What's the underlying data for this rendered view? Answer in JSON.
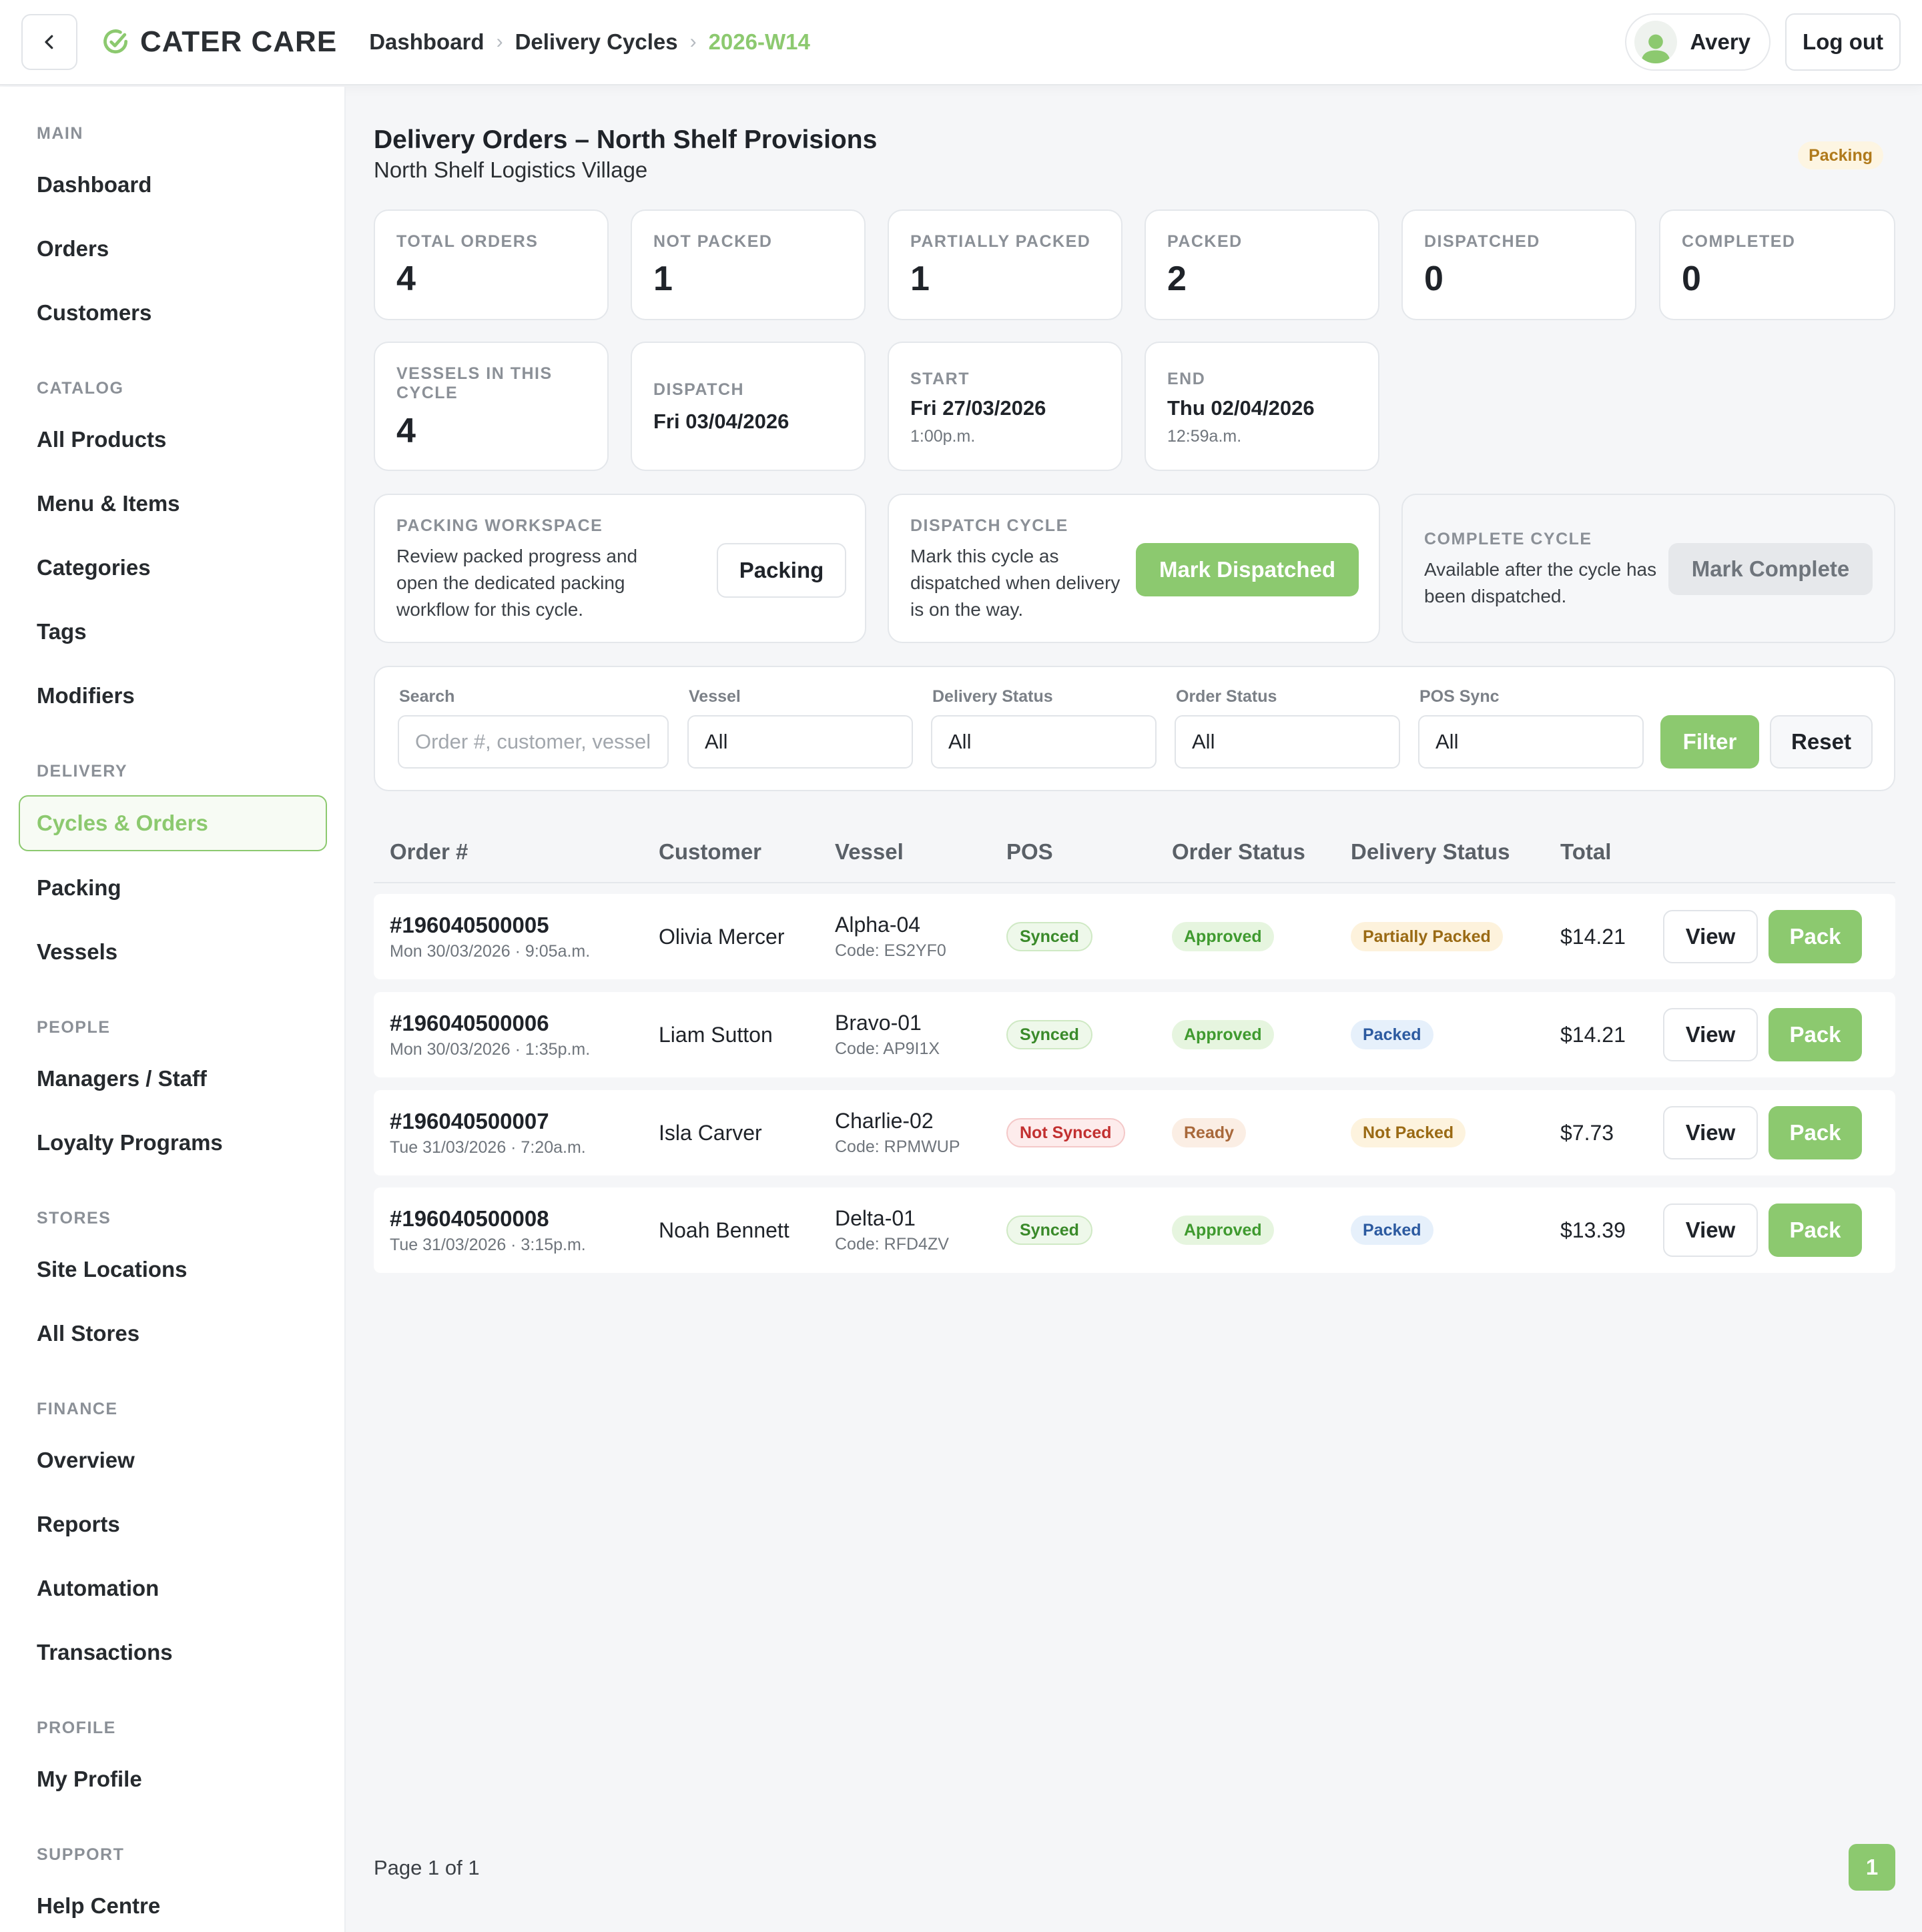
{
  "header": {
    "brand": "CATER CARE",
    "breadcrumbs": [
      "Dashboard",
      "Delivery Cycles",
      "2026-W14"
    ],
    "user_name": "Avery",
    "logout_label": "Log out",
    "accent_color": "#8cc96f"
  },
  "sidebar": {
    "sections": [
      {
        "title": "MAIN",
        "items": [
          "Dashboard",
          "Orders",
          "Customers"
        ]
      },
      {
        "title": "CATALOG",
        "items": [
          "All Products",
          "Menu & Items",
          "Categories",
          "Tags",
          "Modifiers"
        ]
      },
      {
        "title": "DELIVERY",
        "items": [
          "Cycles & Orders",
          "Packing",
          "Vessels"
        ]
      },
      {
        "title": "PEOPLE",
        "items": [
          "Managers / Staff",
          "Loyalty Programs"
        ]
      },
      {
        "title": "STORES",
        "items": [
          "Site Locations",
          "All Stores"
        ]
      },
      {
        "title": "FINANCE",
        "items": [
          "Overview",
          "Reports",
          "Automation",
          "Transactions"
        ]
      },
      {
        "title": "PROFILE",
        "items": [
          "My Profile"
        ]
      },
      {
        "title": "SUPPORT",
        "items": [
          "Help Centre"
        ]
      }
    ],
    "active_item": "Cycles & Orders"
  },
  "page": {
    "title": "Delivery Orders – North Shelf Provisions",
    "subtitle": "North Shelf Logistics Village",
    "status_badge": "Packing"
  },
  "stats": [
    {
      "label": "TOTAL ORDERS",
      "value": "4"
    },
    {
      "label": "NOT PACKED",
      "value": "1"
    },
    {
      "label": "PARTIALLY PACKED",
      "value": "1"
    },
    {
      "label": "PACKED",
      "value": "2"
    },
    {
      "label": "DISPATCHED",
      "value": "0"
    },
    {
      "label": "COMPLETED",
      "value": "0"
    }
  ],
  "cycle_info": {
    "vessels": {
      "label": "VESSELS IN THIS CYCLE",
      "value": "4"
    },
    "dispatch": {
      "label": "DISPATCH",
      "date": "Fri 03/04/2026"
    },
    "start": {
      "label": "START",
      "date": "Fri 27/03/2026",
      "time": "1:00p.m."
    },
    "end": {
      "label": "END",
      "date": "Thu 02/04/2026",
      "time": "12:59a.m."
    }
  },
  "actions": {
    "packing": {
      "label": "PACKING WORKSPACE",
      "desc": "Review packed progress and open the dedicated packing workflow for this cycle.",
      "button": "Packing"
    },
    "dispatch": {
      "label": "DISPATCH CYCLE",
      "desc": "Mark this cycle as dispatched when delivery is on the way.",
      "button": "Mark Dispatched"
    },
    "complete": {
      "label": "COMPLETE CYCLE",
      "desc": "Available after the cycle has been dispatched.",
      "button": "Mark Complete"
    }
  },
  "filters": {
    "search_label": "Search",
    "search_placeholder": "Order #, customer, vessel",
    "vessel_label": "Vessel",
    "vessel_value": "All",
    "delivery_label": "Delivery Status",
    "delivery_value": "All",
    "order_label": "Order Status",
    "order_value": "All",
    "pos_label": "POS Sync",
    "pos_value": "All",
    "filter_button": "Filter",
    "reset_button": "Reset"
  },
  "table": {
    "columns": [
      "Order #",
      "Customer",
      "Vessel",
      "POS",
      "Order Status",
      "Delivery Status",
      "Total"
    ],
    "view_label": "View",
    "pack_label": "Pack",
    "rows": [
      {
        "order": "#196040500005",
        "date": "Mon 30/03/2026 · 9:05a.m.",
        "customer": "Olivia Mercer",
        "vessel": "Alpha-04",
        "code": "Code: ES2YF0",
        "pos": "Synced",
        "order_status": "Approved",
        "delivery_status": "Partially Packed",
        "total": "$14.21"
      },
      {
        "order": "#196040500006",
        "date": "Mon 30/03/2026 · 1:35p.m.",
        "customer": "Liam Sutton",
        "vessel": "Bravo-01",
        "code": "Code: AP9I1X",
        "pos": "Synced",
        "order_status": "Approved",
        "delivery_status": "Packed",
        "total": "$14.21"
      },
      {
        "order": "#196040500007",
        "date": "Tue 31/03/2026 · 7:20a.m.",
        "customer": "Isla Carver",
        "vessel": "Charlie-02",
        "code": "Code: RPMWUP",
        "pos": "Not Synced",
        "order_status": "Ready",
        "delivery_status": "Not Packed",
        "total": "$7.73"
      },
      {
        "order": "#196040500008",
        "date": "Tue 31/03/2026 · 3:15p.m.",
        "customer": "Noah Bennett",
        "vessel": "Delta-01",
        "code": "Code: RFD4ZV",
        "pos": "Synced",
        "order_status": "Approved",
        "delivery_status": "Packed",
        "total": "$13.39"
      }
    ]
  },
  "pagination": {
    "text": "Page 1 of 1",
    "current": "1"
  }
}
